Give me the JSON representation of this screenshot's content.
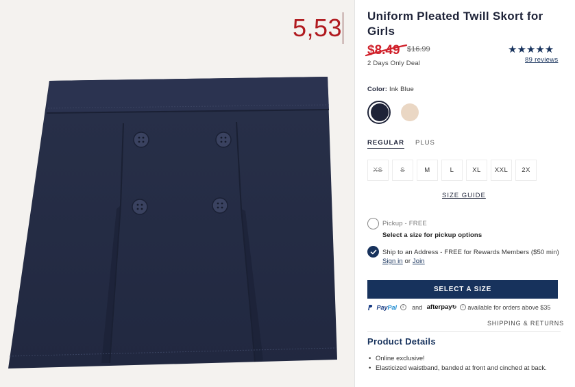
{
  "overlay_price": "5,53",
  "product": {
    "title": "Uniform Pleated Twill Skort for Girls",
    "sale_price": "$8.49",
    "original_price": "$16.99",
    "deal_text": "2 Days Only Deal",
    "stars": "★★★★★",
    "reviews": "89 reviews"
  },
  "color": {
    "label": "Color:",
    "value": "Ink Blue",
    "swatches": [
      {
        "name": "ink-blue",
        "color": "#1e2338"
      },
      {
        "name": "tan",
        "color": "#ead7c4"
      }
    ]
  },
  "tabs": [
    "REGULAR",
    "PLUS"
  ],
  "sizes": [
    {
      "label": "XS",
      "available": false
    },
    {
      "label": "S",
      "available": false
    },
    {
      "label": "M",
      "available": true
    },
    {
      "label": "L",
      "available": true
    },
    {
      "label": "XL",
      "available": true
    },
    {
      "label": "XXL",
      "available": true
    },
    {
      "label": "2X",
      "available": true
    }
  ],
  "size_guide": "SIZE GUIDE",
  "pickup": {
    "label": "Pickup - FREE",
    "sub": "Select a size for pickup options"
  },
  "ship": {
    "text": "Ship to an Address - FREE for Rewards Members ($50 min)",
    "sign_in": "Sign in",
    "or": "or",
    "join": "Join"
  },
  "cta": "SELECT A SIZE",
  "payments": {
    "paypal_a": "Pay",
    "paypal_b": "Pal",
    "and": "and",
    "afterpay": "afterpay",
    "afterpay_mark": "↻",
    "text": "available for orders above $35"
  },
  "shipping_returns": "SHIPPING & RETURNS",
  "details": {
    "title": "Product Details",
    "items": [
      "Online exclusive!",
      "Elasticized waistband, banded at front and cinched at back."
    ]
  }
}
